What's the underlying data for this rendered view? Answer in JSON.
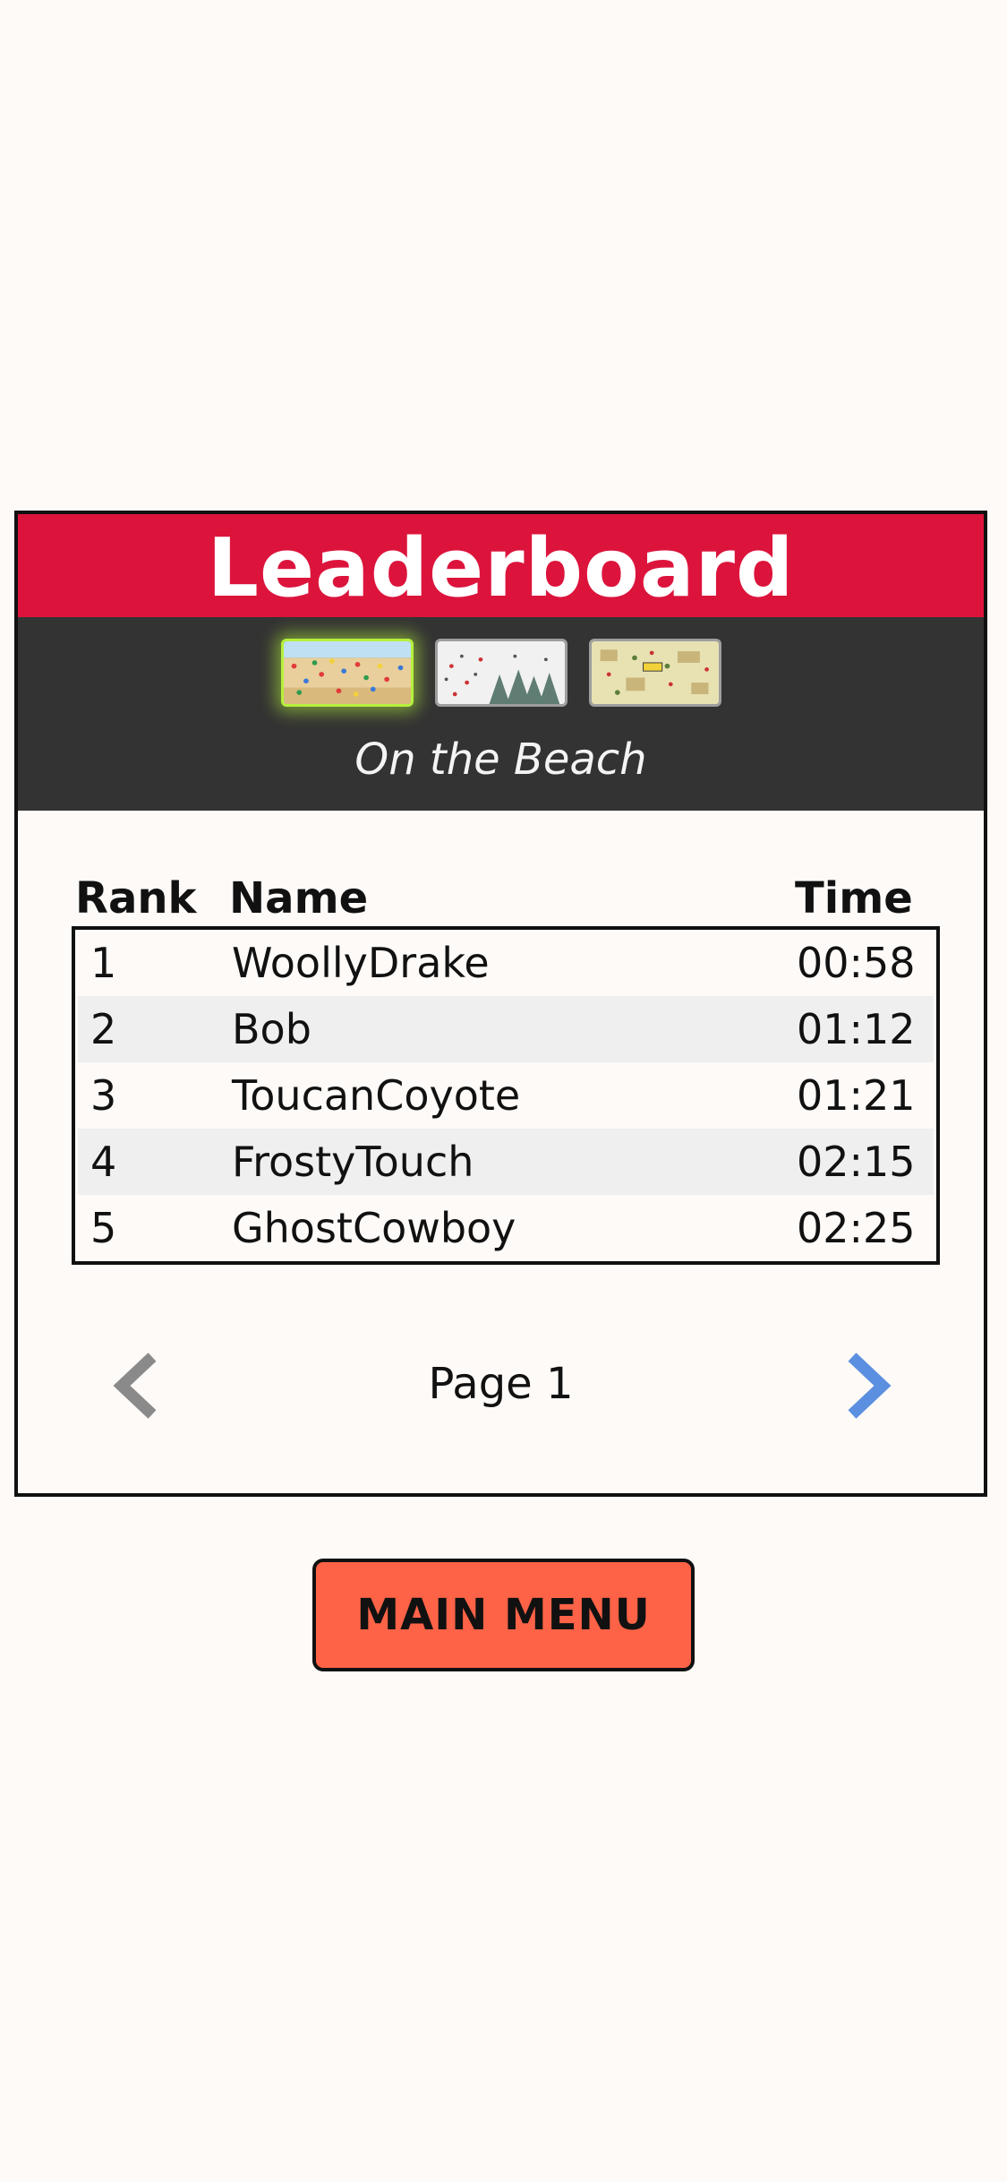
{
  "leaderboard": {
    "title": "Leaderboard",
    "levels": [
      {
        "icon": "beach-level-thumbnail",
        "selected": true
      },
      {
        "icon": "snow-level-thumbnail",
        "selected": false
      },
      {
        "icon": "town-level-thumbnail",
        "selected": false
      }
    ],
    "current_level": "On the Beach",
    "columns": {
      "rank": "Rank",
      "name": "Name",
      "time": "Time"
    },
    "rows": [
      {
        "rank": "1",
        "name": "WoollyDrake",
        "time": "00:58"
      },
      {
        "rank": "2",
        "name": "Bob",
        "time": "01:12"
      },
      {
        "rank": "3",
        "name": "ToucanCoyote",
        "time": "01:21"
      },
      {
        "rank": "4",
        "name": "FrostyTouch",
        "time": "02:15"
      },
      {
        "rank": "5",
        "name": "GhostCowboy",
        "time": "02:25"
      }
    ],
    "pagination": {
      "label": "Page 1",
      "prev_icon": "chevron-left-icon",
      "next_icon": "chevron-right-icon"
    }
  },
  "main_menu_button": "MAIN MENU",
  "colors": {
    "header_red": "#dc143c",
    "level_bar": "#333333",
    "button": "#ff6347",
    "selected_glow": "#b6f03c",
    "next_arrow": "#5b8fe0",
    "prev_arrow": "#8a8a8a"
  }
}
